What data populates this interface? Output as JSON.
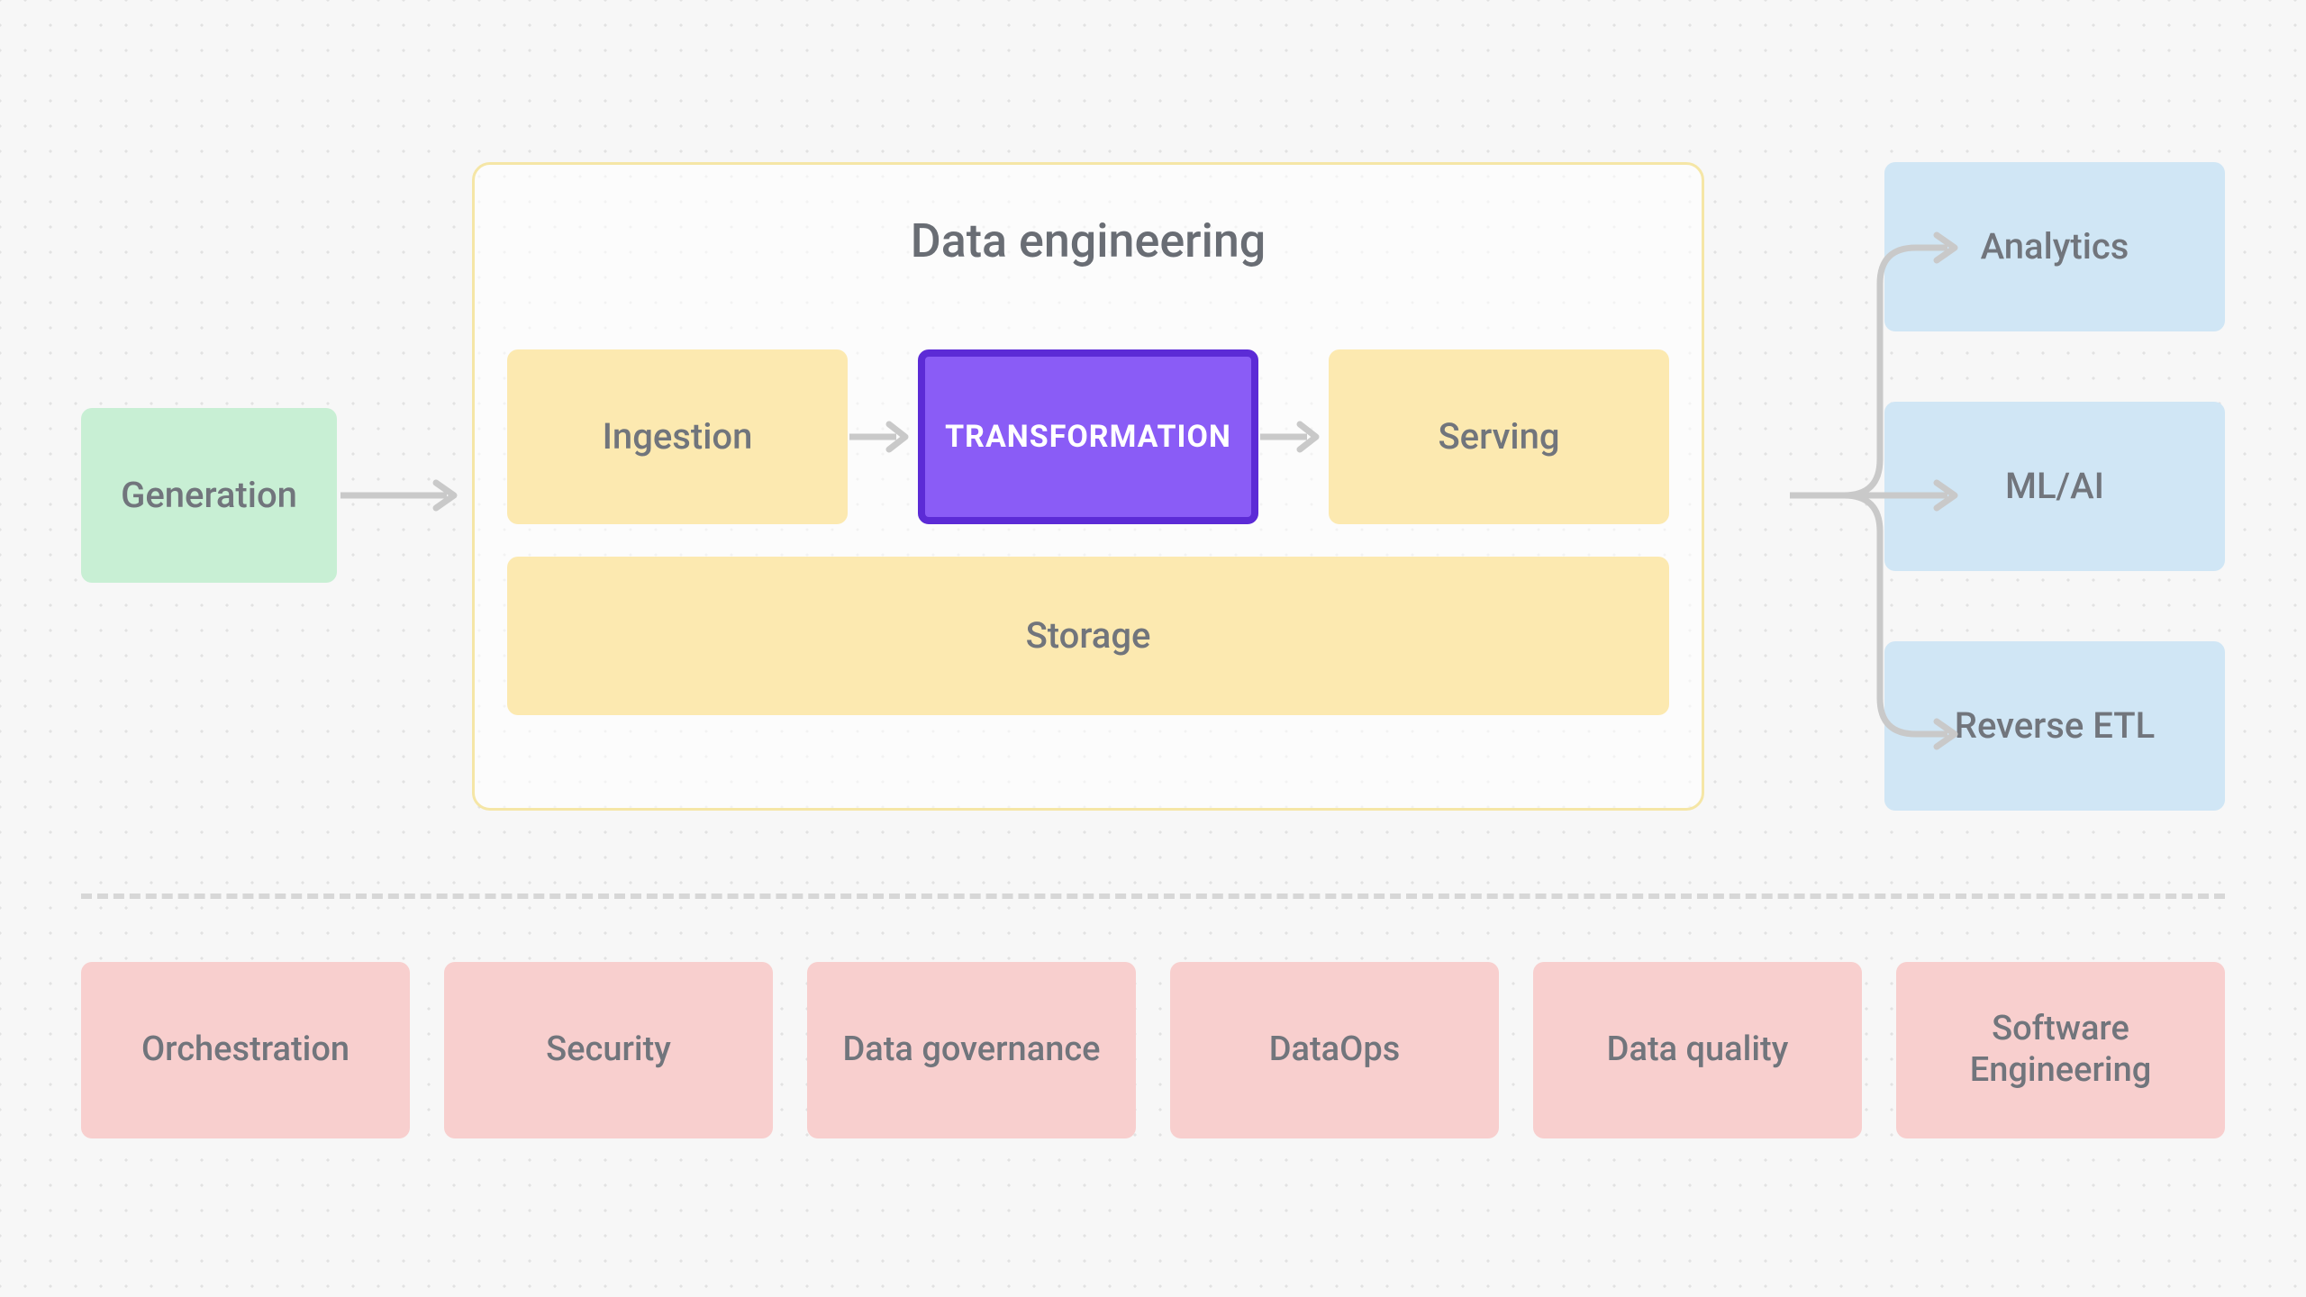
{
  "flow": {
    "generation": "Generation",
    "data_engineering": {
      "title": "Data engineering",
      "ingestion": "Ingestion",
      "transformation": "TRANSFORMATION",
      "serving": "Serving",
      "storage": "Storage"
    },
    "outputs": {
      "analytics": "Analytics",
      "ml_ai": "ML/AI",
      "reverse_etl": "Reverse ETL"
    }
  },
  "undercurrents": {
    "orchestration": "Orchestration",
    "security": "Security",
    "data_governance": "Data governance",
    "dataops": "DataOps",
    "data_quality": "Data quality",
    "software_engineering": "Software Engineering"
  },
  "colors": {
    "green": "#c8efd4",
    "yellow": "#fce9b0",
    "purple_fill": "#8a5cf6",
    "purple_border": "#5c2bd6",
    "blue": "#d0e6f5",
    "red": "#f8cfce",
    "arrow": "#c9c9c9"
  }
}
